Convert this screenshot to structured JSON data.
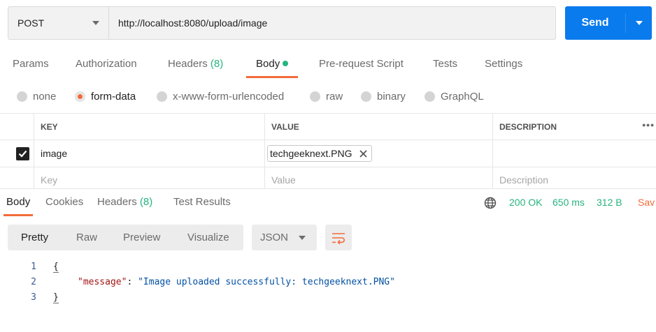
{
  "request": {
    "method": "POST",
    "url": "http://localhost:8080/upload/image",
    "send_label": "Send"
  },
  "request_tabs": [
    {
      "label": "Params",
      "count": ""
    },
    {
      "label": "Authorization",
      "count": ""
    },
    {
      "label": "Headers",
      "count": "(8)"
    },
    {
      "label": "Body",
      "count": ""
    },
    {
      "label": "Pre-request Script",
      "count": ""
    },
    {
      "label": "Tests",
      "count": ""
    },
    {
      "label": "Settings",
      "count": ""
    }
  ],
  "active_request_tab": "Body",
  "body_types": [
    "none",
    "form-data",
    "x-www-form-urlencoded",
    "raw",
    "binary",
    "GraphQL"
  ],
  "selected_body_type": "form-data",
  "params_table": {
    "headers": [
      "KEY",
      "VALUE",
      "DESCRIPTION"
    ],
    "more_label": "•••",
    "rows": [
      {
        "checked": true,
        "key": "image",
        "value": "techgeeknext.PNG",
        "description": ""
      }
    ],
    "placeholders": {
      "key": "Key",
      "value": "Value",
      "description": "Description"
    }
  },
  "response_tabs": [
    {
      "label": "Body",
      "count": ""
    },
    {
      "label": "Cookies",
      "count": ""
    },
    {
      "label": "Headers",
      "count": "(8)"
    },
    {
      "label": "Test Results",
      "count": ""
    }
  ],
  "response_status": {
    "status": "200 OK",
    "time": "650 ms",
    "size": "312 B",
    "save_label": "Sav"
  },
  "view_options": [
    "Pretty",
    "Raw",
    "Preview",
    "Visualize"
  ],
  "active_view": "Pretty",
  "format": "JSON",
  "response_body": {
    "lines": [
      {
        "num": "1",
        "open": "{"
      },
      {
        "num": "2",
        "key": "\"message\"",
        "colon": ": ",
        "value": "\"Image uploaded successfully: techgeeknext.PNG\""
      },
      {
        "num": "3",
        "close": "}"
      }
    ]
  },
  "colors": {
    "accent": "#f26b3a",
    "primary": "#097bed",
    "success": "#26b47f"
  }
}
